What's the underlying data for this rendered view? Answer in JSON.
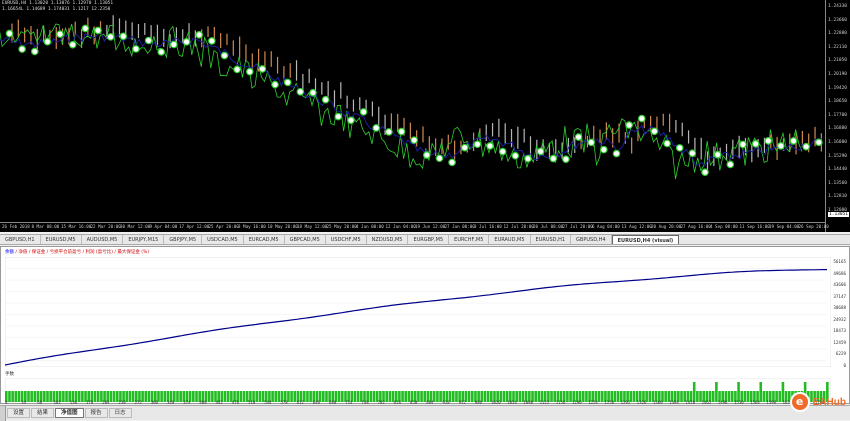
{
  "chart": {
    "header_line1": "EURUSD,H4  1.13020 1.13076 1.12970 1.13051",
    "header_line2": "1.16654L  1.14689  1.174031  1.1217 12.2350",
    "price_ticks": [
      "1.24330",
      "1.23660",
      "1.22880",
      "1.22110",
      "1.21050",
      "1.20190",
      "1.19420",
      "1.18650",
      "1.17700",
      "1.16880",
      "1.16080",
      "1.15290",
      "1.14440",
      "1.13560",
      "1.12810",
      "1.12080"
    ],
    "current_price": "1.13051",
    "time_ticks": [
      "26 Feb 2018",
      "8 Mar 08:00",
      "15 Mar 16:00",
      "22 Mar 20:00",
      "30 Mar 12:00",
      "9 Apr 04:00",
      "17 Apr 12:00",
      "25 Apr 20:00",
      "3 May 16:00",
      "10 May 20:00",
      "18 May 12:00",
      "25 May 20:00",
      "4 Jun 00:00",
      "12 Jun 04:00",
      "19 Jun 12:00",
      "27 Jun 00:00",
      "3 Jul 16:00",
      "12 Jul 20:00",
      "20 Jul 08:00",
      "27 Jul 20:00",
      "6 Aug 04:00",
      "13 Aug 12:00",
      "20 Aug 20:00",
      "27 Aug 16:00",
      "4 Sep 08:00",
      "11 Sep 16:00",
      "19 Sep 04:00",
      "26 Sep 20:00"
    ],
    "colors": {
      "price": "#1e1e9c",
      "cloud_a": "#f4a460",
      "cloud_b": "#d8d8d8",
      "chikou": "#2ed12e",
      "marker": "#2ed12e"
    }
  },
  "chart_tabs": [
    "GBPUSD,H1",
    "EURUSD,M5",
    "AUDUSD,M5",
    "EURJPY,M15",
    "GBPJPY,M5",
    "USDCAD,M5",
    "EURCAD,M5",
    "GBPCAD,M5",
    "USDCHF,M5",
    "NZDUSD,M5",
    "EURGBP,M5",
    "EURCHF,M5",
    "EURAUD,M5",
    "EURUSD,H1",
    "GBPUSD,H4",
    "EURUSD,H4 (visual)"
  ],
  "active_chart_tab": 15,
  "tester": {
    "legend_prefix": "余额",
    "legend_text": " / 净值 / 保证金 / 亏损平仓前盈亏 / 利润 (盈亏比) / 最大保证金 (%)",
    "volume_label": "手数",
    "balance_ticks": [
      "56165",
      "49686",
      "43606",
      "37147",
      "30688",
      "24932",
      "18473",
      "12459",
      "6229",
      "0"
    ],
    "trade_ticks": [
      "0",
      "34",
      "68",
      "102",
      "136",
      "170",
      "204",
      "238",
      "272",
      "306",
      "340",
      "374",
      "408",
      "442",
      "476",
      "510",
      "544",
      "578",
      "612",
      "646",
      "680",
      "714",
      "748",
      "782",
      "816",
      "850",
      "884",
      "918",
      "952",
      "986",
      "1020",
      "1054",
      "1088",
      "1122",
      "1156",
      "1190",
      "1224",
      "1258",
      "1292",
      "1326",
      "1360",
      "1394",
      "1428",
      "1462",
      "1496",
      "1530",
      "1564",
      "1598",
      "1632",
      "1666",
      "1700"
    ],
    "colors": {
      "balance": "#00008b",
      "volume": "#22bb22"
    }
  },
  "bottom_tabs": [
    "设置",
    "结果",
    "净值图",
    "报告",
    "日志"
  ],
  "active_bottom_tab": 2,
  "watermark": {
    "logo": "e",
    "text": "EAHub"
  }
}
